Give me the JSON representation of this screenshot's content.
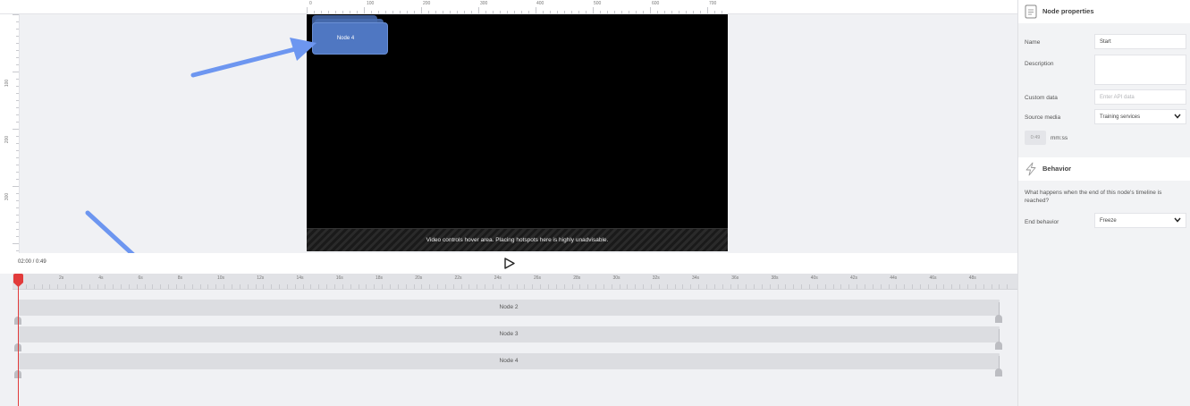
{
  "canvas": {
    "top_ruler_labels": [
      "0",
      "100",
      "200",
      "300",
      "400",
      "500",
      "600",
      "700"
    ],
    "left_ruler_labels": [
      "100",
      "200",
      "300"
    ],
    "hotspot": {
      "label": "Node 4"
    },
    "hover_area_text": "Video controls hover area. Placing hotspots here is highly unadvisable."
  },
  "player": {
    "time_readout": "02:00 / 0:49",
    "play_icon": "play-icon"
  },
  "timeline": {
    "time_labels": [
      "2s",
      "4s",
      "6s",
      "8s",
      "10s",
      "12s",
      "14s",
      "16s",
      "18s",
      "20s",
      "22s",
      "24s",
      "26s",
      "28s",
      "30s",
      "32s",
      "34s",
      "36s",
      "38s",
      "40s",
      "42s",
      "44s",
      "46s",
      "48s"
    ],
    "tracks": [
      {
        "label": "Node 2"
      },
      {
        "label": "Node 3"
      },
      {
        "label": "Node 4"
      }
    ]
  },
  "panel": {
    "node_properties": {
      "title": "Node properties",
      "icon": "document-icon",
      "name_label": "Name",
      "name_value": "Start",
      "description_label": "Description",
      "description_value": "",
      "custom_data_label": "Custom data",
      "custom_data_placeholder": "Enter API data",
      "source_media_label": "Source media",
      "source_media_value": "Training services",
      "time_value": "0:49",
      "time_unit": "mm:ss"
    },
    "behavior": {
      "title": "Behavior",
      "icon": "lightning-icon",
      "description": "What happens when the end of this node's timeline is reached?",
      "end_behavior_label": "End behavior",
      "end_behavior_value": "Freeze"
    }
  },
  "colors": {
    "accent_blue": "#4f77c2",
    "playhead_red": "#e23b3b",
    "arrow_blue": "#6d96f0"
  }
}
